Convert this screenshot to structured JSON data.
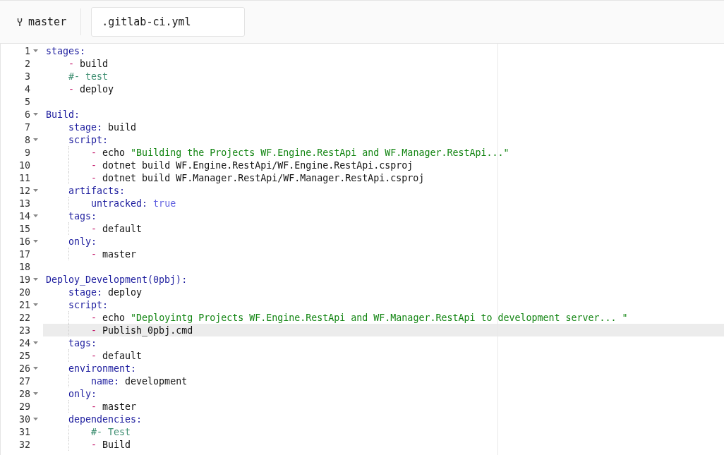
{
  "header": {
    "branch": "master",
    "filename": ".gitlab-ci.yml"
  },
  "editor": {
    "lines": [
      {
        "number": "1",
        "foldable": true,
        "highlighted": false,
        "tokens": [
          {
            "kind": "key",
            "text": "stages:"
          }
        ]
      },
      {
        "number": "2",
        "foldable": false,
        "highlighted": false,
        "tokens": [
          {
            "kind": "dash",
            "text": "    -"
          },
          {
            "kind": "plain",
            "text": " build"
          }
        ]
      },
      {
        "number": "3",
        "foldable": false,
        "highlighted": false,
        "tokens": [
          {
            "kind": "comment",
            "text": "    #- test"
          }
        ]
      },
      {
        "number": "4",
        "foldable": false,
        "highlighted": false,
        "tokens": [
          {
            "kind": "dash",
            "text": "    -"
          },
          {
            "kind": "plain",
            "text": " deploy"
          }
        ]
      },
      {
        "number": "5",
        "foldable": false,
        "highlighted": false
      },
      {
        "number": "6",
        "foldable": true,
        "highlighted": false,
        "tokens": [
          {
            "kind": "key",
            "text": "Build:"
          }
        ]
      },
      {
        "number": "7",
        "foldable": false,
        "highlighted": false,
        "tokens": [
          {
            "kind": "key",
            "text": "    stage:"
          },
          {
            "kind": "plain",
            "text": " build"
          }
        ]
      },
      {
        "number": "8",
        "foldable": true,
        "highlighted": false,
        "tokens": [
          {
            "kind": "key",
            "text": "    script:"
          }
        ]
      },
      {
        "number": "9",
        "foldable": false,
        "highlighted": false,
        "tokens": [
          {
            "kind": "dash",
            "text": "        -"
          },
          {
            "kind": "plain",
            "text": " echo "
          },
          {
            "kind": "string",
            "text": "\"Building the Projects WF.Engine.RestApi and WF.Manager.RestApi...\""
          }
        ]
      },
      {
        "number": "10",
        "foldable": false,
        "highlighted": false,
        "tokens": [
          {
            "kind": "dash",
            "text": "        -"
          },
          {
            "kind": "plain",
            "text": " dotnet build WF.Engine.RestApi/WF.Engine.RestApi.csproj"
          }
        ]
      },
      {
        "number": "11",
        "foldable": false,
        "highlighted": false,
        "tokens": [
          {
            "kind": "dash",
            "text": "        -"
          },
          {
            "kind": "plain",
            "text": " dotnet build WF.Manager.RestApi/WF.Manager.RestApi.csproj"
          }
        ]
      },
      {
        "number": "12",
        "foldable": true,
        "highlighted": false,
        "tokens": [
          {
            "kind": "key",
            "text": "    artifacts:"
          }
        ]
      },
      {
        "number": "13",
        "foldable": false,
        "highlighted": false,
        "tokens": [
          {
            "kind": "key",
            "text": "        untracked:"
          },
          {
            "kind": "bool",
            "text": " true"
          }
        ]
      },
      {
        "number": "14",
        "foldable": true,
        "highlighted": false,
        "tokens": [
          {
            "kind": "key",
            "text": "    tags:"
          }
        ]
      },
      {
        "number": "15",
        "foldable": false,
        "highlighted": false,
        "tokens": [
          {
            "kind": "dash",
            "text": "        -"
          },
          {
            "kind": "plain",
            "text": " default"
          }
        ]
      },
      {
        "number": "16",
        "foldable": true,
        "highlighted": false,
        "tokens": [
          {
            "kind": "key",
            "text": "    only:"
          }
        ]
      },
      {
        "number": "17",
        "foldable": false,
        "highlighted": false,
        "tokens": [
          {
            "kind": "dash",
            "text": "        -"
          },
          {
            "kind": "plain",
            "text": " master"
          }
        ]
      },
      {
        "number": "18",
        "foldable": false,
        "highlighted": false
      },
      {
        "number": "19",
        "foldable": true,
        "highlighted": false,
        "tokens": [
          {
            "kind": "key",
            "text": "Deploy_Development(0pbj):"
          }
        ]
      },
      {
        "number": "20",
        "foldable": false,
        "highlighted": false,
        "tokens": [
          {
            "kind": "key",
            "text": "    stage:"
          },
          {
            "kind": "plain",
            "text": " deploy"
          }
        ]
      },
      {
        "number": "21",
        "foldable": true,
        "highlighted": false,
        "tokens": [
          {
            "kind": "key",
            "text": "    script:"
          }
        ]
      },
      {
        "number": "22",
        "foldable": false,
        "highlighted": false,
        "tokens": [
          {
            "kind": "dash",
            "text": "        -"
          },
          {
            "kind": "plain",
            "text": " echo "
          },
          {
            "kind": "string",
            "text": "\"Deployintg Projects WF.Engine.RestApi and WF.Manager.RestApi to development server... \""
          }
        ]
      },
      {
        "number": "23",
        "foldable": false,
        "highlighted": true,
        "tokens": [
          {
            "kind": "dash",
            "text": "        -"
          },
          {
            "kind": "plain",
            "text": " Publish_0pbj.cmd"
          }
        ]
      },
      {
        "number": "24",
        "foldable": true,
        "highlighted": false,
        "tokens": [
          {
            "kind": "key",
            "text": "    tags:"
          }
        ]
      },
      {
        "number": "25",
        "foldable": false,
        "highlighted": false,
        "tokens": [
          {
            "kind": "dash",
            "text": "        -"
          },
          {
            "kind": "plain",
            "text": " default"
          }
        ]
      },
      {
        "number": "26",
        "foldable": true,
        "highlighted": false,
        "tokens": [
          {
            "kind": "key",
            "text": "    environment:"
          }
        ]
      },
      {
        "number": "27",
        "foldable": false,
        "highlighted": false,
        "tokens": [
          {
            "kind": "key",
            "text": "        name:"
          },
          {
            "kind": "plain",
            "text": " development"
          }
        ]
      },
      {
        "number": "28",
        "foldable": true,
        "highlighted": false,
        "tokens": [
          {
            "kind": "key",
            "text": "    only:"
          }
        ]
      },
      {
        "number": "29",
        "foldable": false,
        "highlighted": false,
        "tokens": [
          {
            "kind": "dash",
            "text": "        -"
          },
          {
            "kind": "plain",
            "text": " master"
          }
        ]
      },
      {
        "number": "30",
        "foldable": true,
        "highlighted": false,
        "tokens": [
          {
            "kind": "key",
            "text": "    dependencies:"
          }
        ]
      },
      {
        "number": "31",
        "foldable": false,
        "highlighted": false,
        "tokens": [
          {
            "kind": "comment",
            "text": "        #- Test"
          }
        ]
      },
      {
        "number": "32",
        "foldable": false,
        "highlighted": false,
        "tokens": [
          {
            "kind": "dash",
            "text": "        -"
          },
          {
            "kind": "plain",
            "text": " Build"
          }
        ]
      }
    ]
  }
}
